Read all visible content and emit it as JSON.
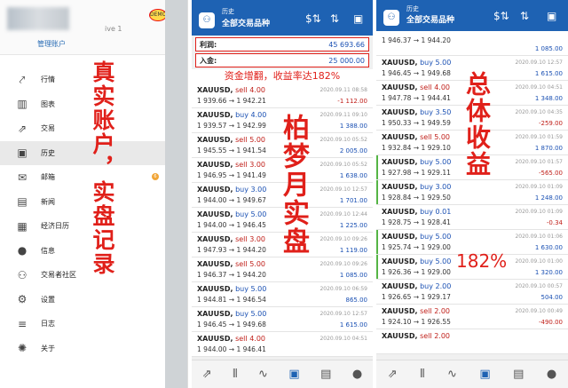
{
  "left": {
    "account_num": "ive 1",
    "badge": "DEMO",
    "manage": "管理账户",
    "menu": [
      {
        "icon": "chart-icon",
        "glyph": "⤤",
        "label": "行情"
      },
      {
        "icon": "chart-bars-icon",
        "glyph": "▥",
        "label": "图表"
      },
      {
        "icon": "trade-icon",
        "glyph": "⇗",
        "label": "交易"
      },
      {
        "icon": "history-icon",
        "glyph": "▣",
        "label": "历史"
      },
      {
        "icon": "mail-icon",
        "glyph": "✉",
        "label": "邮箱",
        "badge": "6"
      },
      {
        "icon": "news-icon",
        "glyph": "▤",
        "label": "新闻"
      },
      {
        "icon": "calendar-icon",
        "glyph": "▦",
        "label": "经济日历"
      },
      {
        "icon": "chat-icon",
        "glyph": "●",
        "label": "信息"
      },
      {
        "icon": "community-icon",
        "glyph": "⚇",
        "label": "交易者社区"
      },
      {
        "icon": "gear-icon",
        "glyph": "⚙",
        "label": "设置"
      },
      {
        "icon": "log-icon",
        "glyph": "≡",
        "label": "日志"
      },
      {
        "icon": "about-icon",
        "glyph": "✺",
        "label": "关于"
      }
    ],
    "overlay_text": "真实账户，实盘记录"
  },
  "mid": {
    "header_small": "历史",
    "header_title": "全部交易品种",
    "profit_label": "利润:",
    "profit_value": "45 693.66",
    "deposit_label": "入金:",
    "deposit_value": "25 000.00",
    "caption": "资金增翻，收益率达182%",
    "overlay_text": "柏梦月实盘",
    "rows": [
      {
        "sym": "XAUUSD,",
        "side": "sell",
        "lot": "4.00",
        "open": "1 939.66",
        "close": "1 942.21",
        "date": "2020.09.11 08:58",
        "pl": "-1 112.00"
      },
      {
        "sym": "XAUUSD,",
        "side": "buy",
        "lot": "4.00",
        "open": "1 939.57",
        "close": "1 942.99",
        "date": "2020.09.11 09:10",
        "pl": "1 388.00"
      },
      {
        "sym": "XAUUSD,",
        "side": "sell",
        "lot": "5.00",
        "open": "1 945.55",
        "close": "1 941.54",
        "date": "2020.09.10 05:52",
        "pl": "2 005.00"
      },
      {
        "sym": "XAUUSD,",
        "side": "sell",
        "lot": "3.00",
        "open": "1 946.95",
        "close": "1 941.49",
        "date": "2020.09.10 05:52",
        "pl": "1 638.00"
      },
      {
        "sym": "XAUUSD,",
        "side": "buy",
        "lot": "3.00",
        "open": "1 944.00",
        "close": "1 949.67",
        "date": "2020.09.10 12:57",
        "pl": "1 701.00"
      },
      {
        "sym": "XAUUSD,",
        "side": "buy",
        "lot": "5.00",
        "open": "1 944.00",
        "close": "1 946.45",
        "date": "2020.09.10 12:44",
        "pl": "1 225.00"
      },
      {
        "sym": "XAUUSD,",
        "side": "sell",
        "lot": "3.00",
        "open": "1 947.93",
        "close": "1 944.20",
        "date": "2020.09.10 09:26",
        "pl": "1 119.00"
      },
      {
        "sym": "XAUUSD,",
        "side": "sell",
        "lot": "5.00",
        "open": "1 946.37",
        "close": "1 944.20",
        "date": "2020.09.10 09:26",
        "pl": "1 085.00"
      },
      {
        "sym": "XAUUSD,",
        "side": "buy",
        "lot": "5.00",
        "open": "1 944.81",
        "close": "1 946.54",
        "date": "2020.09.10 06:59",
        "pl": "865.00"
      },
      {
        "sym": "XAUUSD,",
        "side": "buy",
        "lot": "5.00",
        "open": "1 946.45",
        "close": "1 949.68",
        "date": "2020.09.10 12:57",
        "pl": "1 615.00"
      },
      {
        "sym": "XAUUSD,",
        "side": "sell",
        "lot": "4.00",
        "open": "1 944.00",
        "close": "1 946.41",
        "date": "2020.09.10 04:51",
        "pl": ""
      }
    ]
  },
  "right": {
    "header_small": "历史",
    "header_title": "全部交易品种",
    "overlay_text": "总体收益",
    "overlay_pct": "182%",
    "rows": [
      {
        "sym": "",
        "side": "",
        "lot": "",
        "open": "1 946.37",
        "close": "1 944.20",
        "date": "",
        "pl": "1 085.00",
        "partial": true
      },
      {
        "sym": "XAUUSD,",
        "side": "buy",
        "lot": "5.00",
        "open": "1 946.45",
        "close": "1 949.68",
        "date": "2020.09.10 12:57",
        "pl": "1 615.00"
      },
      {
        "sym": "XAUUSD,",
        "side": "sell",
        "lot": "4.00",
        "open": "1 947.78",
        "close": "1 944.41",
        "date": "2020.09.10 04:51",
        "pl": "1 348.00"
      },
      {
        "sym": "XAUUSD,",
        "side": "buy",
        "lot": "3.50",
        "open": "1 950.33",
        "close": "1 949.59",
        "date": "2020.09.10 04:35",
        "pl": "-259.00"
      },
      {
        "sym": "XAUUSD,",
        "side": "sell",
        "lot": "5.00",
        "open": "1 932.84",
        "close": "1 929.10",
        "date": "2020.09.10 01:59",
        "pl": "1 870.00"
      },
      {
        "sym": "XAUUSD,",
        "side": "buy",
        "lot": "5.00",
        "open": "1 927.98",
        "close": "1 929.11",
        "date": "2020.09.10 01:57",
        "pl": "-565.00",
        "bar": true
      },
      {
        "sym": "XAUUSD,",
        "side": "buy",
        "lot": "3.00",
        "open": "1 928.84",
        "close": "1 929.50",
        "date": "2020.09.10 01:09",
        "pl": "1 248.00",
        "bar": true
      },
      {
        "sym": "XAUUSD,",
        "side": "buy",
        "lot": "0.01",
        "open": "1 928.75",
        "close": "1 928.41",
        "date": "2020.09.10 01:09",
        "pl": "-0.34"
      },
      {
        "sym": "XAUUSD,",
        "side": "buy",
        "lot": "5.00",
        "open": "1 925.74",
        "close": "1 929.00",
        "date": "2020.09.10 01:06",
        "pl": "1 630.00",
        "bar": true
      },
      {
        "sym": "XAUUSD,",
        "side": "buy",
        "lot": "5.00",
        "open": "1 926.36",
        "close": "1 929.00",
        "date": "2020.09.10 01:00",
        "pl": "1 320.00",
        "bar": true
      },
      {
        "sym": "XAUUSD,",
        "side": "buy",
        "lot": "2.00",
        "open": "1 926.65",
        "close": "1 929.17",
        "date": "2020.09.10 00:57",
        "pl": "504.00"
      },
      {
        "sym": "XAUUSD,",
        "side": "sell",
        "lot": "2.00",
        "open": "1 924.10",
        "close": "1 926.55",
        "date": "2020.09.10 00:49",
        "pl": "-490.00"
      },
      {
        "sym": "XAUUSD,",
        "side": "sell",
        "lot": "2.00",
        "open": "",
        "close": "",
        "date": "",
        "pl": ""
      }
    ]
  },
  "bottom_nav": [
    {
      "icon": "quotes-icon",
      "glyph": "⇗"
    },
    {
      "icon": "chart-icon",
      "glyph": "⫴"
    },
    {
      "icon": "trade-icon",
      "glyph": "∿"
    },
    {
      "icon": "history-icon",
      "glyph": "▣"
    },
    {
      "icon": "news-icon",
      "glyph": "▤"
    },
    {
      "icon": "chat-icon",
      "glyph": "●"
    }
  ]
}
